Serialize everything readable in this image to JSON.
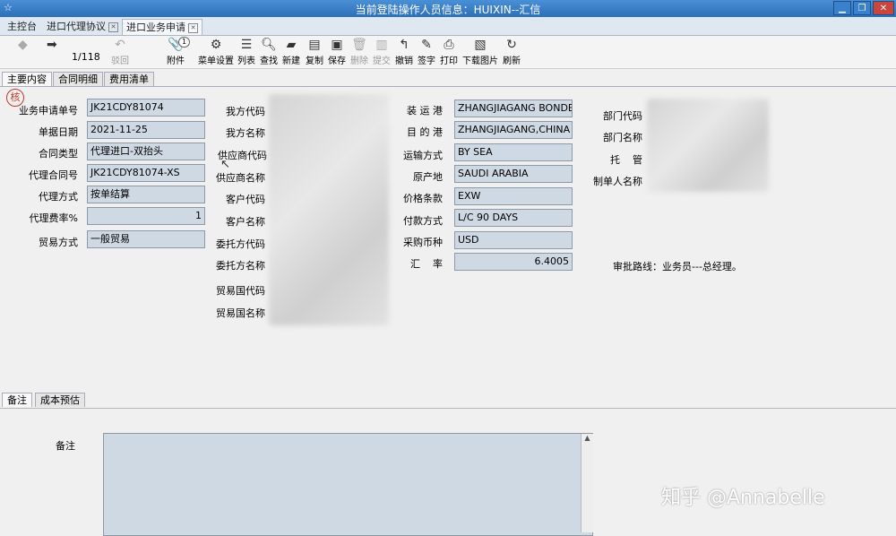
{
  "window": {
    "title": "当前登陆操作人员信息：HUIXIN--汇信"
  },
  "doc_tabs": [
    {
      "label": "主控台"
    },
    {
      "label": "进口代理协议"
    },
    {
      "label": "进口业务申请"
    }
  ],
  "toolbar": {
    "pager": "1/118",
    "attach_count": "1",
    "buttons": [
      {
        "label": "驳回"
      },
      {
        "label": "附件"
      },
      {
        "label": "菜单设置"
      },
      {
        "label": "列表"
      },
      {
        "label": "查找"
      },
      {
        "label": "新建"
      },
      {
        "label": "复制"
      },
      {
        "label": "保存"
      },
      {
        "label": "删除"
      },
      {
        "label": "提交"
      },
      {
        "label": "撤销"
      },
      {
        "label": "签字"
      },
      {
        "label": "打印"
      },
      {
        "label": "下载图片"
      },
      {
        "label": "刷新"
      }
    ]
  },
  "subtabs": [
    {
      "label": "主要内容"
    },
    {
      "label": "合同明细"
    },
    {
      "label": "费用清单"
    }
  ],
  "stamp": "核",
  "left_fields": [
    {
      "label": "业务申请单号",
      "value": "JK21CDY81074"
    },
    {
      "label": "单据日期",
      "value": "2021-11-25"
    },
    {
      "label": "合同类型",
      "value": "代理进口-双抬头"
    },
    {
      "label": "代理合同号",
      "value": "JK21CDY81074-XS"
    },
    {
      "label": "代理方式",
      "value": "按单结算"
    },
    {
      "label": "代理费率%",
      "value": "1"
    },
    {
      "label": "贸易方式",
      "value": "一般贸易"
    }
  ],
  "mid_labels": [
    "我方代码",
    "我方名称",
    "供应商代码",
    "供应商名称",
    "客户代码",
    "客户名称",
    "委托方代码",
    "委托方名称",
    "贸易国代码",
    "贸易国名称"
  ],
  "right_fields": [
    {
      "label": "装 运 港",
      "value": "ZHANGJIAGANG BONDED"
    },
    {
      "label": "目 的 港",
      "value": "ZHANGJIAGANG,CHINA"
    },
    {
      "label": "运输方式",
      "value": "BY SEA"
    },
    {
      "label": "原产地",
      "value": "SAUDI ARABIA"
    },
    {
      "label": "价格条款",
      "value": "EXW"
    },
    {
      "label": "付款方式",
      "value": "L/C 90 DAYS"
    },
    {
      "label": "采购币种",
      "value": "USD"
    },
    {
      "label": "汇    率",
      "value": "6.4005"
    }
  ],
  "far_labels": [
    "部门代码",
    "部门名称",
    "托    管",
    "制单人名称"
  ],
  "approval_route": "审批路线：业务员---总经理。",
  "bottom_tabs": [
    {
      "label": "备注"
    },
    {
      "label": "成本预估"
    }
  ],
  "remarks_label": "备注",
  "watermark": "知乎 @Annabelle"
}
